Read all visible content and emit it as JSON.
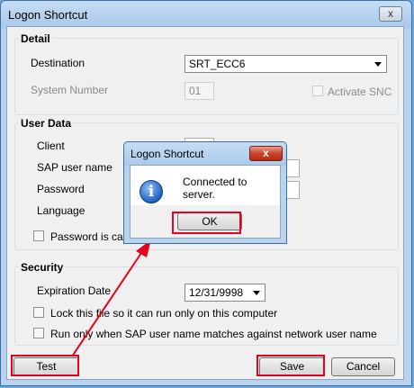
{
  "window": {
    "title": "Logon Shortcut",
    "close_glyph": "x"
  },
  "detail": {
    "title": "Detail",
    "destination_label": "Destination",
    "destination_value": "SRT_ECC6",
    "system_number_label": "System Number",
    "system_number_value": "01",
    "activate_snc_label": "Activate SNC"
  },
  "user_data": {
    "title": "User Data",
    "client_label": "Client",
    "sap_user_label": "SAP user name",
    "password_label": "Password",
    "language_label": "Language",
    "password_case_label": "Password is case"
  },
  "security": {
    "title": "Security",
    "expiration_label": "Expiration Date",
    "expiration_value": "12/31/9998",
    "lock_file_label": "Lock this file so it can run only on this computer",
    "run_only_label": "Run only when SAP user name matches against network user name"
  },
  "buttons": {
    "test": "Test",
    "save": "Save",
    "cancel": "Cancel"
  },
  "dialog": {
    "title": "Logon Shortcut",
    "close_glyph": "x",
    "message": "Connected to server.",
    "ok": "OK",
    "icon": "info-icon"
  },
  "colors": {
    "highlight": "#e8001c"
  }
}
